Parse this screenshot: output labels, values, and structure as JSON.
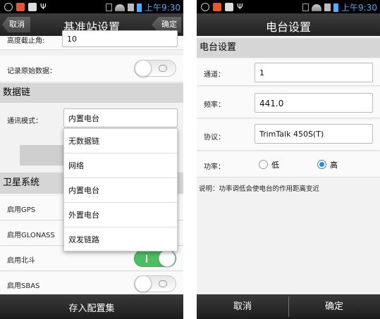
{
  "left_screen": {
    "status_bar": {
      "time": "上午9:30"
    },
    "title": "基准站设置",
    "cancel_label": "取消",
    "ok_label": "确定",
    "antenna_height": {
      "label": "高度截止角:",
      "value": "10"
    },
    "record_raw": {
      "label": "记录原始数据：",
      "on": false
    },
    "datalink_section": "数据链",
    "comm_mode": {
      "label": "通讯模式：",
      "value": "内置电台"
    },
    "dropdown_options": [
      "无数据链",
      "网络",
      "内置电台",
      "外置电台",
      "双发链路"
    ],
    "satellite_section": "卫星系统",
    "satellites": [
      {
        "label": "启用GPS",
        "on": true
      },
      {
        "label": "启用GLONASS",
        "on": true
      },
      {
        "label": "启用北斗",
        "on": true
      },
      {
        "label": "启用SBAS",
        "on": false
      }
    ],
    "save_button": "存入配置集"
  },
  "right_screen": {
    "status_bar": {
      "time": "上午9:30"
    },
    "title": "电台设置",
    "section": "电台设置",
    "channel": {
      "label": "通道：",
      "value": "1"
    },
    "frequency": {
      "label": "频率：",
      "value": "441.0"
    },
    "protocol": {
      "label": "协议：",
      "value": "TrimTalk 450S(T)"
    },
    "power": {
      "label": "功率：",
      "options": [
        "低",
        "高"
      ],
      "selected": "高"
    },
    "note": "说明：功率调低会使电台的作用距离变近",
    "cancel_button": "取消",
    "ok_button": "确定"
  },
  "colors": {
    "accent_blue": "#2a8cd8",
    "toggle_green": "#4cbf5e",
    "statusbar_time": "#4ab0ff"
  }
}
